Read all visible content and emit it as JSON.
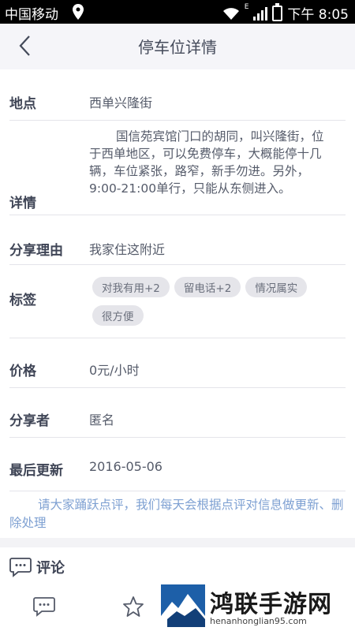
{
  "status_bar": {
    "carrier": "中国移动",
    "time": "下午 8:05",
    "network": "E"
  },
  "header": {
    "title": "停车位详情"
  },
  "details": {
    "location_label": "地点",
    "location_value": "西单兴隆街",
    "detail_label": "详情",
    "detail_value": "国信苑宾馆门口的胡同，叫兴隆街，位于西单地区，可以免费停车，大概能停十几辆，车位紧张，路窄，新手勿进。另外，9:00-21:00单行，只能从东侧进入。",
    "share_reason_label": "分享理由",
    "share_reason_value": "我家住这附近",
    "tags_label": "标签",
    "tags": [
      "对我有用+2",
      "留电话+2",
      "情况属实",
      "很方便"
    ],
    "price_label": "价格",
    "price_value": "0元/小时",
    "sharer_label": "分享者",
    "sharer_value": "匿名",
    "updated_label": "最后更新",
    "updated_value": "2016-05-06"
  },
  "notice": "请大家踊跃点评，我们每天会根据点评对信息做更新、删除处理",
  "comments": {
    "title": "评论"
  },
  "watermark": {
    "name": "鸿联手游网",
    "url": "henanhonglian95.com"
  },
  "colors": {
    "notice": "#7ea0d2",
    "header_bg": "#f5f5f9",
    "tag_bg": "#e5e5ea"
  }
}
